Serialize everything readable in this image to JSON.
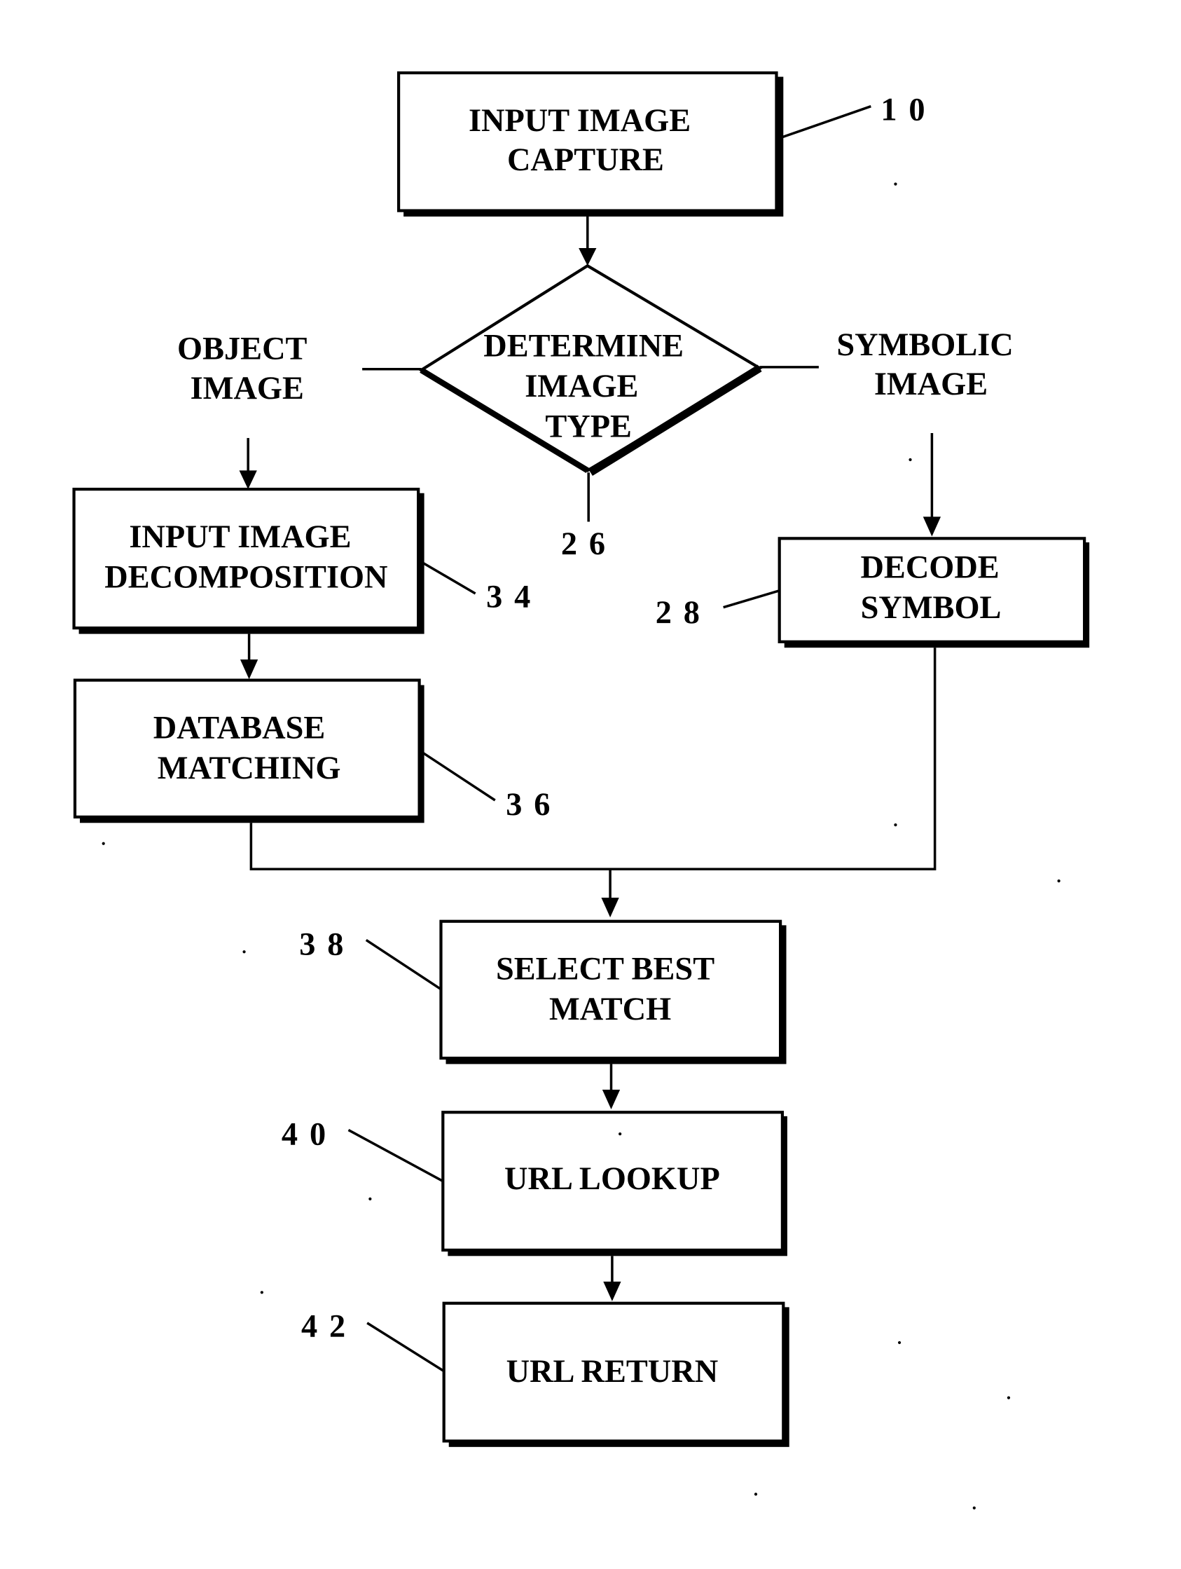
{
  "diagram": {
    "type": "flowchart",
    "nodes": {
      "capture": {
        "ref": "10",
        "lines": [
          "INPUT IMAGE",
          "CAPTURE"
        ]
      },
      "determine": {
        "ref": "26",
        "lines": [
          "DETERMINE",
          "IMAGE",
          "TYPE"
        ]
      },
      "object_branch": {
        "lines": [
          "OBJECT",
          "IMAGE"
        ]
      },
      "symbolic_branch": {
        "lines": [
          "SYMBOLIC",
          "IMAGE"
        ]
      },
      "decomposition": {
        "ref": "34",
        "lines": [
          "INPUT IMAGE",
          "DECOMPOSITION"
        ]
      },
      "db_matching": {
        "ref": "36",
        "lines": [
          "DATABASE",
          "MATCHING"
        ]
      },
      "decode": {
        "ref": "28",
        "lines": [
          "DECODE",
          "SYMBOL"
        ]
      },
      "best_match": {
        "ref": "38",
        "lines": [
          "SELECT BEST",
          "MATCH"
        ]
      },
      "url_lookup": {
        "ref": "40",
        "lines": [
          "URL LOOKUP"
        ]
      },
      "url_return": {
        "ref": "42",
        "lines": [
          "URL RETURN"
        ]
      }
    },
    "edges": [
      [
        "capture",
        "determine"
      ],
      [
        "determine",
        "object_branch"
      ],
      [
        "determine",
        "symbolic_branch"
      ],
      [
        "object_branch",
        "decomposition"
      ],
      [
        "decomposition",
        "db_matching"
      ],
      [
        "symbolic_branch",
        "decode"
      ],
      [
        "db_matching",
        "best_match"
      ],
      [
        "decode",
        "best_match"
      ],
      [
        "best_match",
        "url_lookup"
      ],
      [
        "url_lookup",
        "url_return"
      ]
    ]
  }
}
